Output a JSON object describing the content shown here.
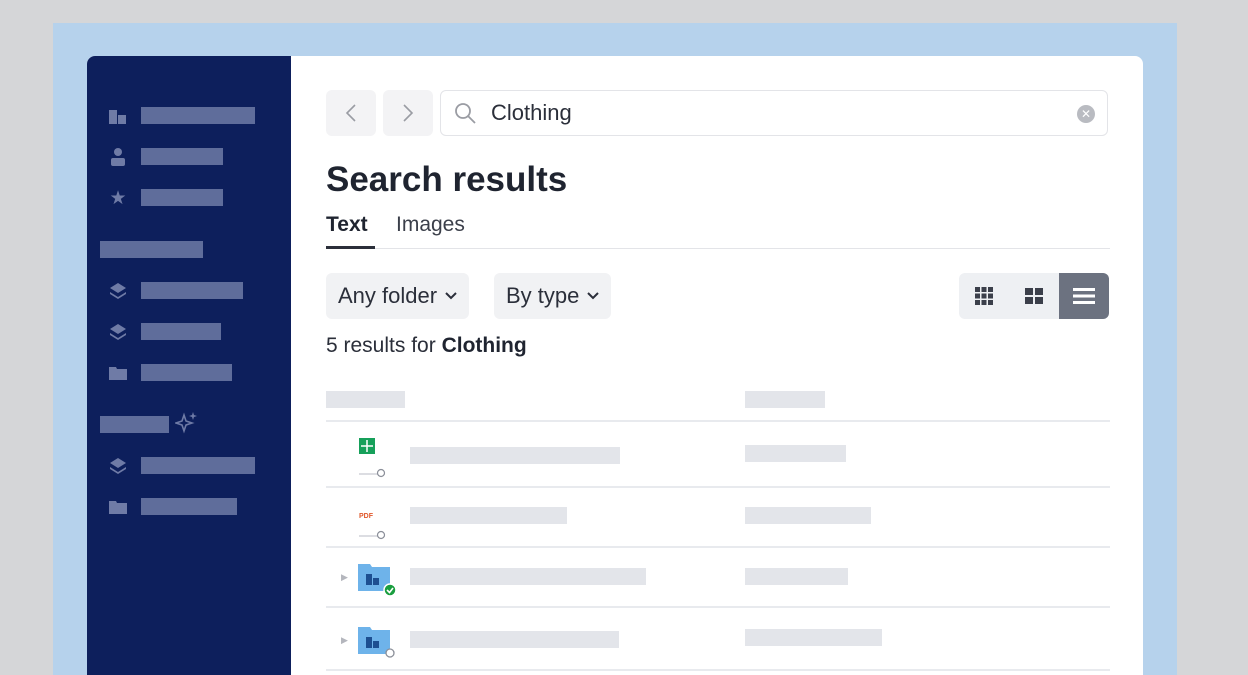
{
  "sidebar": {
    "items": [
      {
        "icon": "building-icon"
      },
      {
        "icon": "person-icon"
      },
      {
        "icon": "star-icon"
      },
      {
        "icon": "section-heading"
      },
      {
        "icon": "stack-icon"
      },
      {
        "icon": "stack-icon"
      },
      {
        "icon": "folder-icon"
      },
      {
        "icon": "sparkle-heading"
      },
      {
        "icon": "stack-icon"
      },
      {
        "icon": "folder-icon"
      }
    ]
  },
  "search": {
    "value": "Clothing"
  },
  "page": {
    "title": "Search results"
  },
  "tabs": [
    {
      "label": "Text"
    },
    {
      "label": "Images"
    }
  ],
  "filters": {
    "folder_label": "Any folder",
    "type_label": "By type"
  },
  "results": {
    "count_prefix": "5 results for",
    "query": "Clothing",
    "rows": [
      {
        "icon": "spreadsheet-icon"
      },
      {
        "icon": "pdf-icon",
        "icon_text": "PDF"
      },
      {
        "icon": "shared-folder-icon",
        "synced": true
      },
      {
        "icon": "shared-folder-icon",
        "synced": false
      }
    ]
  },
  "colors": {
    "sidebar": "#0d1f5c",
    "accent_active_view": "#6c7280",
    "sync_ok": "#1a9e3f",
    "spreadsheet": "#16a05a",
    "pdf": "#e0572a",
    "folder": "#6eb3ea"
  }
}
